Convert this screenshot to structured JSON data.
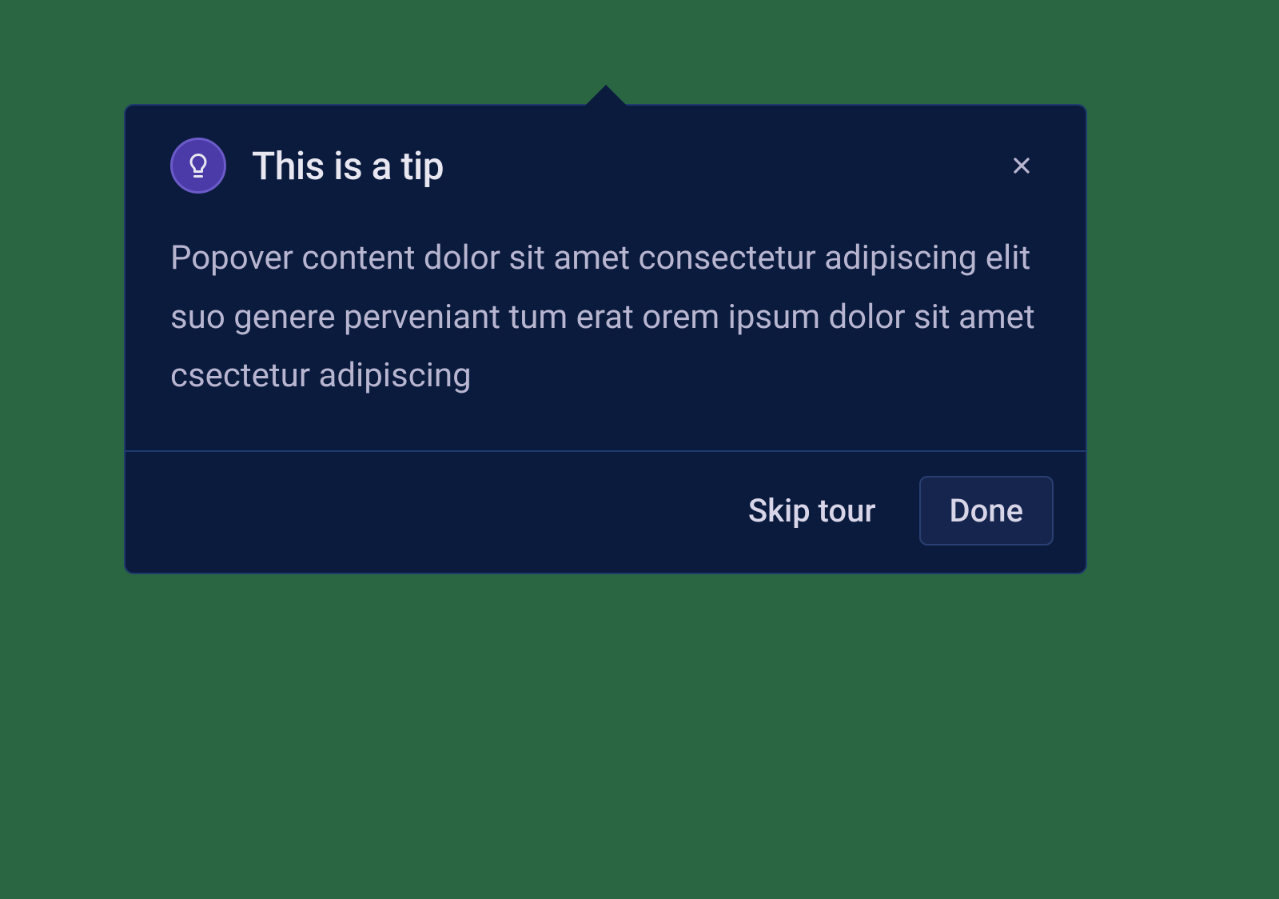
{
  "popover": {
    "title": "This is a tip",
    "content": "Popover content dolor sit amet consectetur adipiscing elit suo genere perveniant tum erat orem ipsum dolor sit amet csectetur adipiscing",
    "actions": {
      "skip_label": "Skip tour",
      "done_label": "Done"
    },
    "icons": {
      "header": "lightbulb-icon",
      "close": "close-icon"
    },
    "colors": {
      "background": "#0a1b3d",
      "border": "#1e3a6e",
      "icon_bg": "#4a3ba8",
      "icon_border": "#6b5bc9",
      "title_text": "#e8e6f0",
      "body_text": "#b8b5d0",
      "button_bg": "#15254d"
    }
  }
}
